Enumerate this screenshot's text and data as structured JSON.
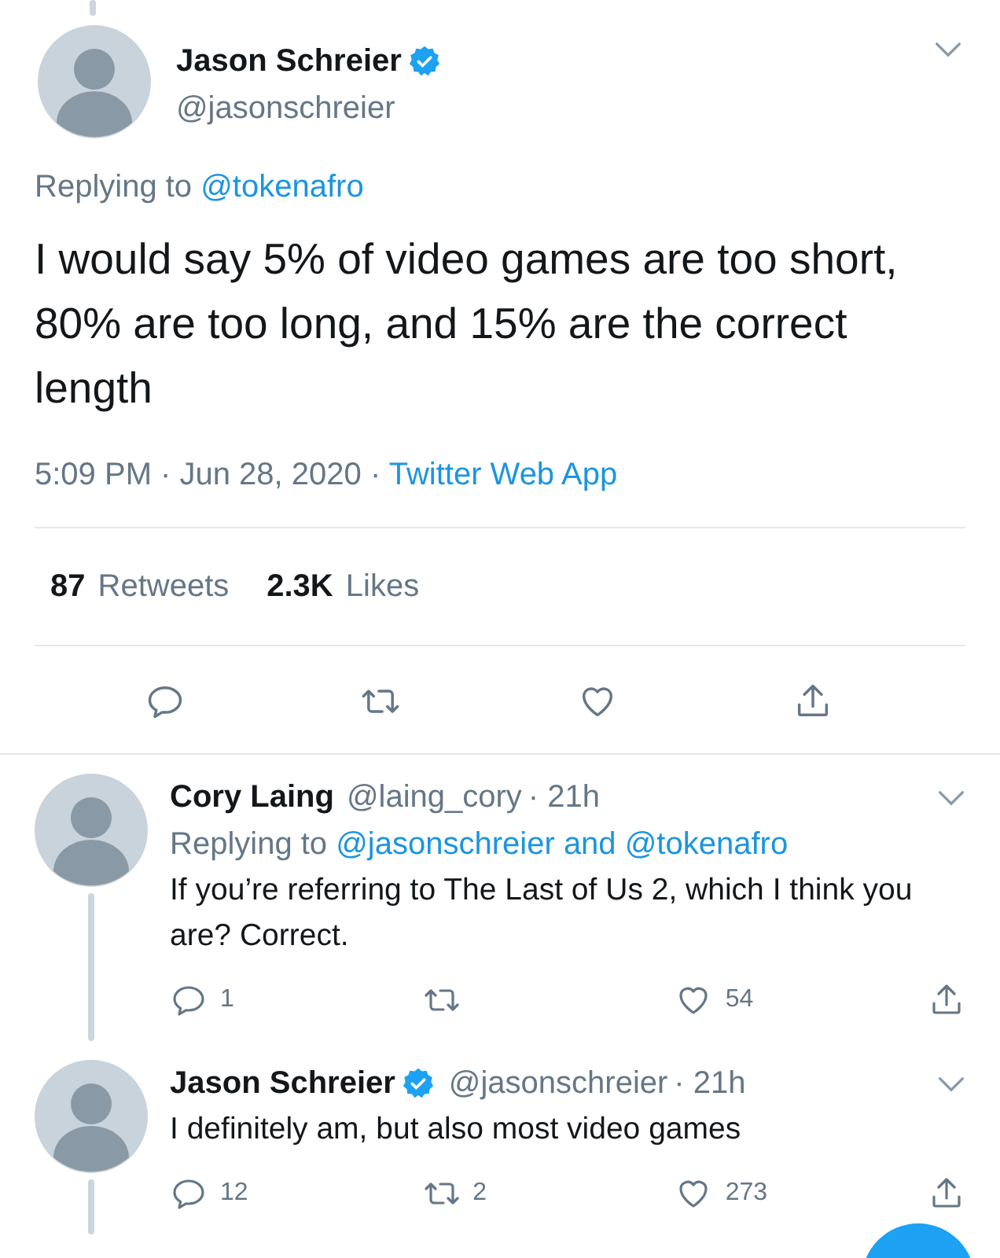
{
  "thread_line_above": true,
  "main_tweet": {
    "name": "Jason Schreier",
    "verified": true,
    "handle": "@jasonschreier",
    "replying_to": [
      {
        "kind": "text",
        "text": "Replying to"
      },
      {
        "kind": "link",
        "text": "@tokenafro"
      }
    ],
    "text": "I would say 5% of video games are too short, 80% are too long, and 15% are the correct length",
    "meta": [
      {
        "kind": "text",
        "text": "5:09 PM · Jun 28, 2020 ·"
      },
      {
        "kind": "link",
        "text": "Twitter Web App"
      }
    ],
    "stats": [
      {
        "count": "87",
        "label": "Retweets"
      },
      {
        "count": "2.3K",
        "label": "Likes"
      }
    ],
    "actions": [
      {
        "kind": "reply"
      },
      {
        "kind": "retweet"
      },
      {
        "kind": "like"
      },
      {
        "kind": "share"
      }
    ]
  },
  "replies": [
    {
      "name": "Cory Laing",
      "verified": false,
      "handle": "@laing_cory",
      "time": "· 21h",
      "thread_line": true,
      "replying_to": [
        {
          "kind": "text",
          "text": "Replying to"
        },
        {
          "kind": "link",
          "text": "@jasonschreier"
        },
        {
          "kind": "link",
          "text": "and"
        },
        {
          "kind": "link",
          "text": "@tokenafro"
        }
      ],
      "text": "If you’re referring to The Last of Us 2, which I think you are? Correct.",
      "actions": [
        {
          "kind": "reply",
          "count": "1"
        },
        {
          "kind": "retweet"
        },
        {
          "kind": "like",
          "count": "54"
        },
        {
          "kind": "share"
        }
      ]
    },
    {
      "name": "Jason Schreier",
      "verified": true,
      "handle": "@jasonschreier",
      "time": "· 21h",
      "thread_line": true,
      "text": "I definitely am, but also most video games",
      "actions": [
        {
          "kind": "reply",
          "count": "12"
        },
        {
          "kind": "retweet",
          "count": "2"
        },
        {
          "kind": "like",
          "count": "273"
        },
        {
          "kind": "share"
        }
      ]
    }
  ],
  "compose_button": {
    "visible": true
  }
}
